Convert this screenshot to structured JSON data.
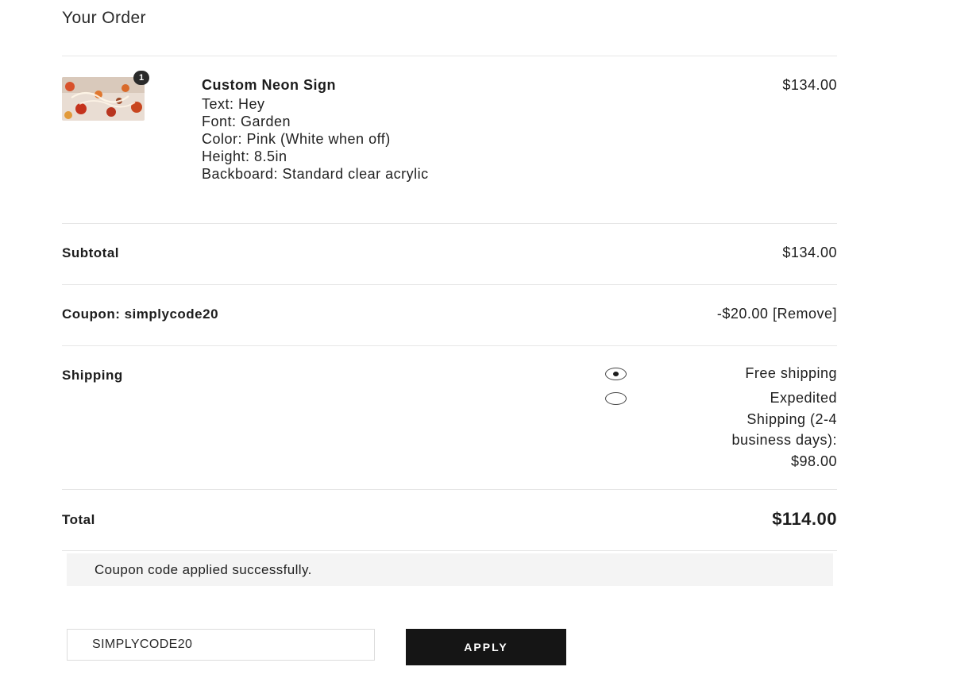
{
  "order": {
    "title": "Your Order",
    "item": {
      "quantity": "1",
      "name": "Custom Neon Sign",
      "price": "$134.00",
      "attributes": [
        "Text: Hey",
        "Font: Garden",
        "Color: Pink (White when off)",
        "Height: 8.5in",
        "Backboard: Standard clear acrylic"
      ]
    },
    "subtotal": {
      "label": "Subtotal",
      "value": "$134.00"
    },
    "coupon": {
      "label": "Coupon: simplycode20",
      "value": "-$20.00",
      "remove_label": "[Remove]"
    },
    "shipping": {
      "label": "Shipping",
      "options": [
        {
          "lines": [
            "Free shipping"
          ],
          "selected": true
        },
        {
          "lines": [
            "Expedited",
            "Shipping (2-4",
            "business days):",
            "$98.00"
          ],
          "selected": false
        }
      ]
    },
    "total": {
      "label": "Total",
      "value": "$114.00"
    }
  },
  "notice": {
    "message": "Coupon code applied successfully."
  },
  "coupon_form": {
    "input_value": "SIMPLYCODE20",
    "apply_label": "APPLY"
  },
  "colors": {
    "button_bg": "#151515",
    "notice_bg": "#f4f4f4",
    "divider": "#e6e6e6"
  }
}
